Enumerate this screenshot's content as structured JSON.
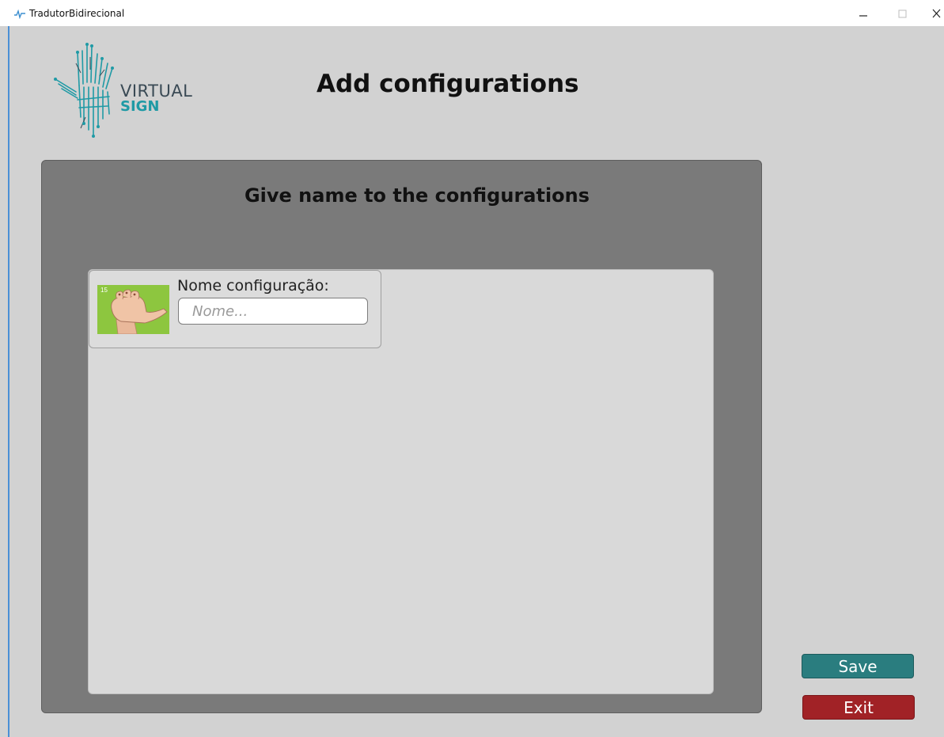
{
  "window": {
    "title": "TradutorBidirecional",
    "app_icon": "signal-icon",
    "controls": [
      "minimize-icon",
      "maximize-icon",
      "close-icon"
    ]
  },
  "logo": {
    "icon": "circuit-hand-icon",
    "line1": "VIRTUAL",
    "line2": "SIGN",
    "colors": {
      "text": "#3a4a55",
      "accent": "#1f9aa5"
    }
  },
  "header": {
    "title": "Add configurations"
  },
  "panel": {
    "title": "Give name to the configurations",
    "configs": [
      {
        "image_number": "15",
        "image_icon": "hand-sign-icon",
        "label": "Nome configuração:",
        "input_value": "",
        "input_placeholder": "Nome..."
      }
    ]
  },
  "buttons": {
    "save_label": "Save",
    "exit_label": "Exit",
    "colors": {
      "save": "#2a7d7f",
      "exit": "#a12226"
    }
  }
}
